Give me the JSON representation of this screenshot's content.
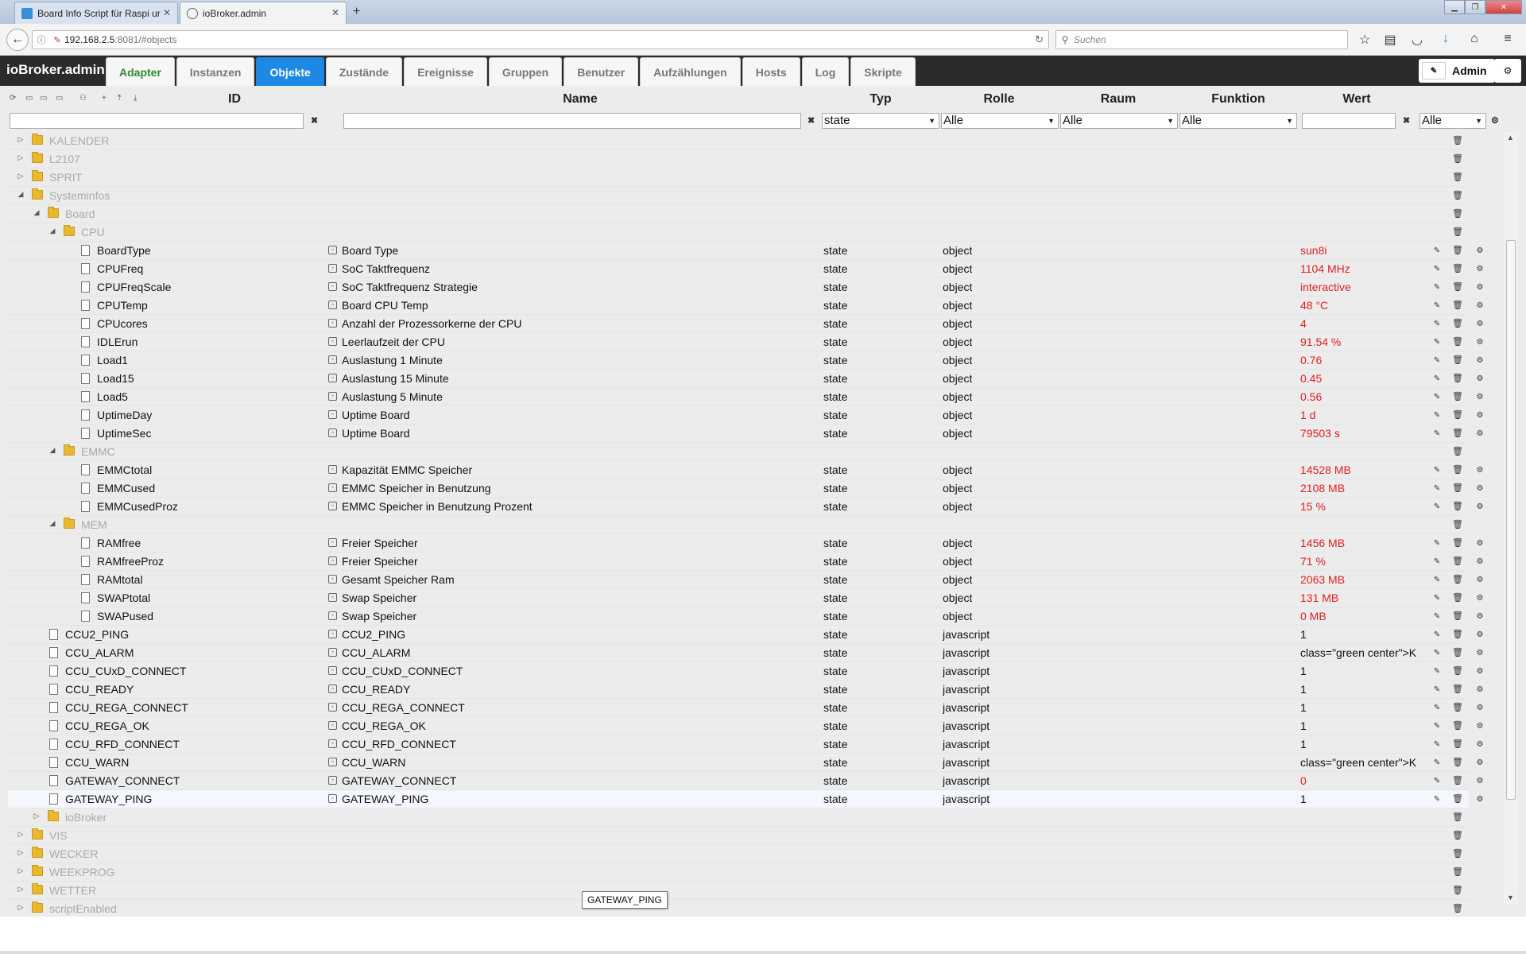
{
  "browser": {
    "tabs": [
      {
        "title": "Board Info Script für Raspi ur",
        "active": false
      },
      {
        "title": "ioBroker.admin",
        "active": true
      }
    ],
    "url_host": "192.168.2.5",
    "url_rest": ":8081/#objects",
    "search_placeholder": "Suchen"
  },
  "app": {
    "title": "ioBroker.admin",
    "tabs": [
      "Adapter",
      "Instanzen",
      "Objekte",
      "Zustände",
      "Ereignisse",
      "Gruppen",
      "Benutzer",
      "Aufzählungen",
      "Hosts",
      "Log",
      "Skripte"
    ],
    "active_tab": "Objekte",
    "user": "Admin"
  },
  "columns": {
    "id": "ID",
    "name": "Name",
    "type": "Typ",
    "role": "Rolle",
    "room": "Raum",
    "function": "Funktion",
    "value": "Wert"
  },
  "filters": {
    "type": "state",
    "role": "Alle",
    "room": "Alle",
    "function": "Alle",
    "value": "Alle"
  },
  "rows": [
    {
      "kind": "folder",
      "level": 1,
      "expanded": false,
      "id": "KALENDER"
    },
    {
      "kind": "folder",
      "level": 1,
      "expanded": false,
      "id": "L2107"
    },
    {
      "kind": "folder",
      "level": 1,
      "expanded": false,
      "id": "SPRIT"
    },
    {
      "kind": "folder",
      "level": 1,
      "expanded": true,
      "id": "Systeminfos"
    },
    {
      "kind": "folder",
      "level": 2,
      "expanded": true,
      "id": "Board"
    },
    {
      "kind": "folder",
      "level": 3,
      "expanded": true,
      "id": "CPU"
    },
    {
      "kind": "state",
      "level": 4,
      "id": "BoardType",
      "name": "Board Type",
      "type": "state",
      "role": "object",
      "value": "sun8i",
      "red": true
    },
    {
      "kind": "state",
      "level": 4,
      "id": "CPUFreq",
      "name": "SoC Taktfrequenz",
      "type": "state",
      "role": "object",
      "value": "1104 MHz",
      "red": true
    },
    {
      "kind": "state",
      "level": 4,
      "id": "CPUFreqScale",
      "name": "SoC Taktfrequenz Strategie",
      "type": "state",
      "role": "object",
      "value": "interactive",
      "red": true
    },
    {
      "kind": "state",
      "level": 4,
      "id": "CPUTemp",
      "name": "Board CPU Temp",
      "type": "state",
      "role": "object",
      "value": "48 °C",
      "red": true
    },
    {
      "kind": "state",
      "level": 4,
      "id": "CPUcores",
      "name": "Anzahl der Prozessorkerne der CPU",
      "type": "state",
      "role": "object",
      "value": "4",
      "red": true
    },
    {
      "kind": "state",
      "level": 4,
      "id": "IDLErun",
      "name": "Leerlaufzeit der CPU",
      "type": "state",
      "role": "object",
      "value": "91.54 %",
      "red": true
    },
    {
      "kind": "state",
      "level": 4,
      "id": "Load1",
      "name": "Auslastung 1 Minute",
      "type": "state",
      "role": "object",
      "value": "0.76",
      "red": true
    },
    {
      "kind": "state",
      "level": 4,
      "id": "Load15",
      "name": "Auslastung 15 Minute",
      "type": "state",
      "role": "object",
      "value": "0.45",
      "red": true
    },
    {
      "kind": "state",
      "level": 4,
      "id": "Load5",
      "name": "Auslastung 5 Minute",
      "type": "state",
      "role": "object",
      "value": "0.56",
      "red": true
    },
    {
      "kind": "state",
      "level": 4,
      "id": "UptimeDay",
      "name": "Uptime Board",
      "type": "state",
      "role": "object",
      "value": "1 d",
      "red": true
    },
    {
      "kind": "state",
      "level": 4,
      "id": "UptimeSec",
      "name": "Uptime Board",
      "type": "state",
      "role": "object",
      "value": "79503 s",
      "red": true
    },
    {
      "kind": "folder",
      "level": 3,
      "expanded": true,
      "id": "EMMC"
    },
    {
      "kind": "state",
      "level": 4,
      "id": "EMMCtotal",
      "name": "Kapazität EMMC Speicher",
      "type": "state",
      "role": "object",
      "value": "14528 MB",
      "red": true
    },
    {
      "kind": "state",
      "level": 4,
      "id": "EMMCused",
      "name": "EMMC Speicher in Benutzung",
      "type": "state",
      "role": "object",
      "value": "2108 MB",
      "red": true
    },
    {
      "kind": "state",
      "level": 4,
      "id": "EMMCusedProz",
      "name": "EMMC Speicher in Benutzung Prozent",
      "type": "state",
      "role": "object",
      "value": "15 %",
      "red": true
    },
    {
      "kind": "folder",
      "level": 3,
      "expanded": true,
      "id": "MEM"
    },
    {
      "kind": "state",
      "level": 4,
      "id": "RAMfree",
      "name": "Freier Speicher",
      "type": "state",
      "role": "object",
      "value": "1456 MB",
      "red": true
    },
    {
      "kind": "state",
      "level": 4,
      "id": "RAMfreeProz",
      "name": "Freier Speicher",
      "type": "state",
      "role": "object",
      "value": "71 %",
      "red": true
    },
    {
      "kind": "state",
      "level": 4,
      "id": "RAMtotal",
      "name": "Gesamt Speicher Ram",
      "type": "state",
      "role": "object",
      "value": "2063 MB",
      "red": true
    },
    {
      "kind": "state",
      "level": 4,
      "id": "SWAPtotal",
      "name": "Swap Speicher",
      "type": "state",
      "role": "object",
      "value": "131 MB",
      "red": true
    },
    {
      "kind": "state",
      "level": 4,
      "id": "SWAPused",
      "name": "Swap Speicher",
      "type": "state",
      "role": "object",
      "value": "0 MB",
      "red": true
    },
    {
      "kind": "state",
      "level": 2,
      "id": "CCU2_PING",
      "name": "CCU2_PING",
      "type": "state",
      "role": "javascript",
      "value": "1",
      "red": false
    },
    {
      "kind": "state",
      "level": 2,
      "id": "CCU_ALARM",
      "name": "CCU_ALARM",
      "type": "state",
      "role": "javascript",
      "value": "class=\"green center\">K",
      "red": false
    },
    {
      "kind": "state",
      "level": 2,
      "id": "CCU_CUxD_CONNECT",
      "name": "CCU_CUxD_CONNECT",
      "type": "state",
      "role": "javascript",
      "value": "1",
      "red": false
    },
    {
      "kind": "state",
      "level": 2,
      "id": "CCU_READY",
      "name": "CCU_READY",
      "type": "state",
      "role": "javascript",
      "value": "1",
      "red": false
    },
    {
      "kind": "state",
      "level": 2,
      "id": "CCU_REGA_CONNECT",
      "name": "CCU_REGA_CONNECT",
      "type": "state",
      "role": "javascript",
      "value": "1",
      "red": false
    },
    {
      "kind": "state",
      "level": 2,
      "id": "CCU_REGA_OK",
      "name": "CCU_REGA_OK",
      "type": "state",
      "role": "javascript",
      "value": "1",
      "red": false
    },
    {
      "kind": "state",
      "level": 2,
      "id": "CCU_RFD_CONNECT",
      "name": "CCU_RFD_CONNECT",
      "type": "state",
      "role": "javascript",
      "value": "1",
      "red": false
    },
    {
      "kind": "state",
      "level": 2,
      "id": "CCU_WARN",
      "name": "CCU_WARN",
      "type": "state",
      "role": "javascript",
      "value": "class=\"green center\">K",
      "red": false
    },
    {
      "kind": "state",
      "level": 2,
      "id": "GATEWAY_CONNECT",
      "name": "GATEWAY_CONNECT",
      "type": "state",
      "role": "javascript",
      "value": "0",
      "red": true
    },
    {
      "kind": "state",
      "level": 2,
      "id": "GATEWAY_PING",
      "name": "GATEWAY_PING",
      "type": "state",
      "role": "javascript",
      "value": "1",
      "red": false,
      "highlight": true
    },
    {
      "kind": "folder",
      "level": 2,
      "expanded": false,
      "id": "ioBroker"
    },
    {
      "kind": "folder",
      "level": 1,
      "expanded": false,
      "id": "VIS"
    },
    {
      "kind": "folder",
      "level": 1,
      "expanded": false,
      "id": "WECKER"
    },
    {
      "kind": "folder",
      "level": 1,
      "expanded": false,
      "id": "WEEKPROG"
    },
    {
      "kind": "folder",
      "level": 1,
      "expanded": false,
      "id": "WETTER"
    },
    {
      "kind": "folder",
      "level": 1,
      "expanded": false,
      "id": "scriptEnabled"
    }
  ],
  "tooltip": "GATEWAY_PING"
}
